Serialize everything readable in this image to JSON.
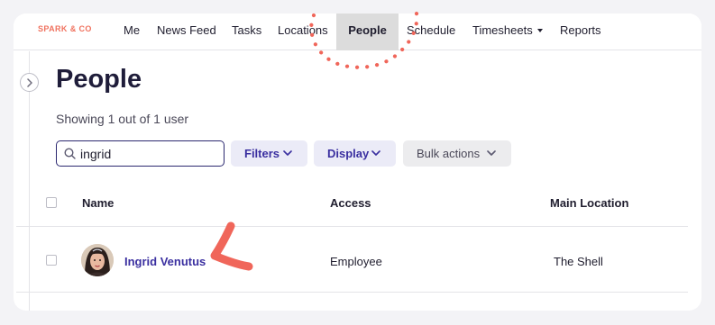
{
  "brand": "SPARK & CO",
  "nav": {
    "items": [
      {
        "label": "Me"
      },
      {
        "label": "News Feed"
      },
      {
        "label": "Tasks"
      },
      {
        "label": "Locations"
      },
      {
        "label": "People",
        "active": true
      },
      {
        "label": "Schedule"
      },
      {
        "label": "Timesheets",
        "has_dropdown": true
      },
      {
        "label": "Reports"
      }
    ]
  },
  "page": {
    "title": "People",
    "showing": "Showing 1 out of 1 user"
  },
  "search": {
    "value": "ingrid"
  },
  "toolbar": {
    "filters": "Filters",
    "display": "Display",
    "bulk_actions": "Bulk actions"
  },
  "table": {
    "columns": [
      "Name",
      "Access",
      "Main Location"
    ],
    "rows": [
      {
        "name": "Ingrid Venutus",
        "access": "Employee",
        "main_location": "The Shell"
      }
    ]
  },
  "colors": {
    "brand": "#f0725f",
    "accent": "#3a2fa0",
    "annotation": "#f0665a",
    "active_tab": "#dcdcdc"
  },
  "icons": [
    "chevron-right-icon",
    "search-icon",
    "chevron-down-icon",
    "avatar"
  ]
}
